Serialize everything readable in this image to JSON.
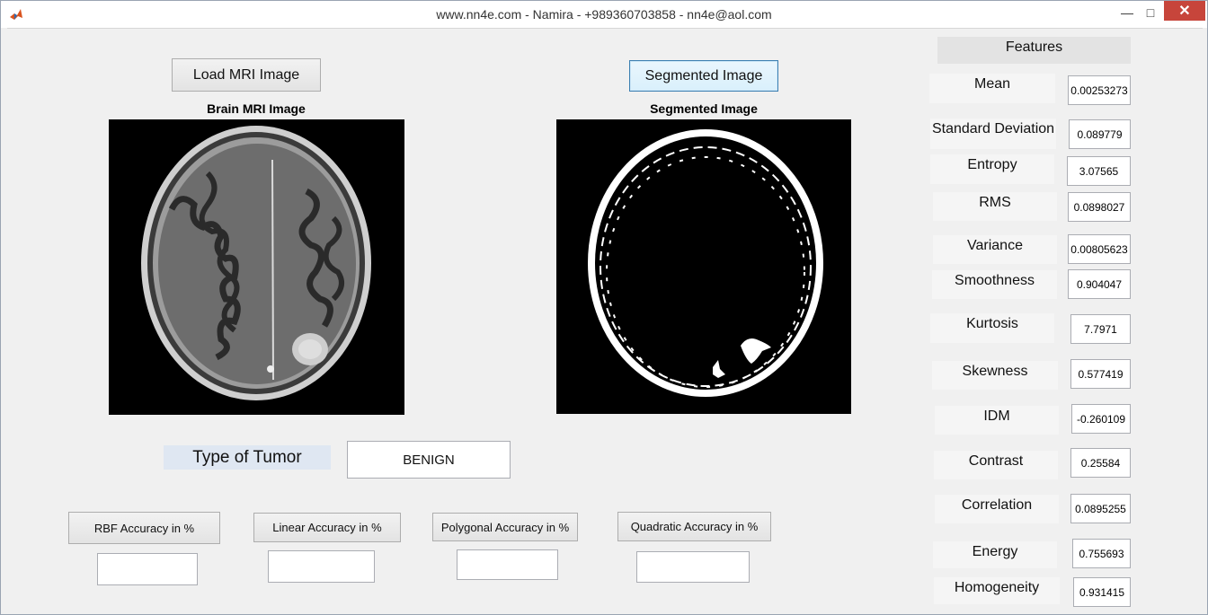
{
  "window": {
    "title": "www.nn4e.com - Namira - +989360703858 - nn4e@aol.com",
    "minimize_icon": "minimize-icon",
    "maximize_icon": "maximize-icon",
    "close_icon": "close-icon"
  },
  "buttons": {
    "load": "Load MRI Image",
    "segmented": "Segmented Image"
  },
  "axes": {
    "brain_title": "Brain MRI Image",
    "segmented_title": "Segmented Image"
  },
  "tumor": {
    "label": "Type of Tumor",
    "value": "BENIGN"
  },
  "accuracy": {
    "rbf": "RBF Accuracy in %",
    "linear": "Linear Accuracy in %",
    "polygonal": "Polygonal Accuracy in %",
    "quadratic": "Quadratic Accuracy in %",
    "rbf_value": "",
    "linear_value": "",
    "polygonal_value": "",
    "quadratic_value": ""
  },
  "features": {
    "header": "Features",
    "items": [
      {
        "label": "Mean",
        "value": "0.00253273"
      },
      {
        "label": "Standard Deviation",
        "value": "0.089779"
      },
      {
        "label": "Entropy",
        "value": "3.07565"
      },
      {
        "label": "RMS",
        "value": "0.0898027"
      },
      {
        "label": "Variance",
        "value": "0.00805623"
      },
      {
        "label": "Smoothness",
        "value": "0.904047"
      },
      {
        "label": "Kurtosis",
        "value": "7.7971"
      },
      {
        "label": "Skewness",
        "value": "0.577419"
      },
      {
        "label": "IDM",
        "value": "-0.260109"
      },
      {
        "label": "Contrast",
        "value": "0.25584"
      },
      {
        "label": "Correlation",
        "value": "0.0895255"
      },
      {
        "label": "Energy",
        "value": "0.755693"
      },
      {
        "label": "Homogeneity",
        "value": "0.931415"
      }
    ]
  }
}
